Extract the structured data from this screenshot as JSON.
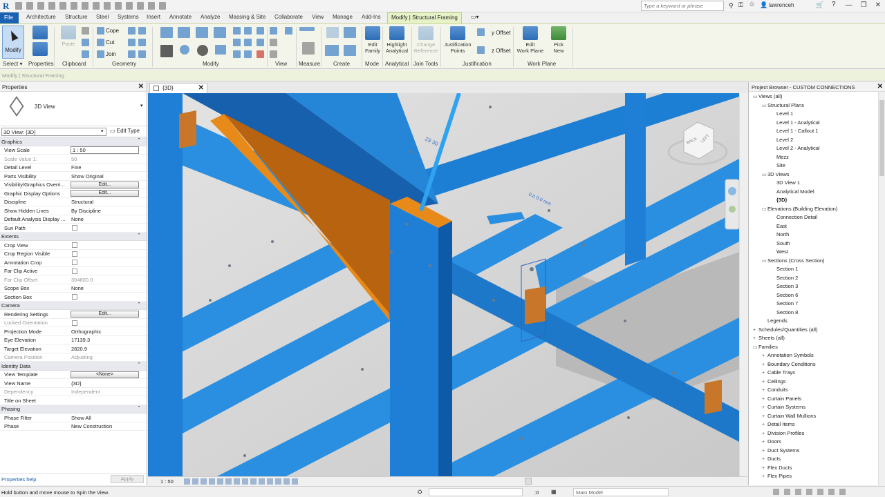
{
  "qat": {
    "logo": "R",
    "search_placeholder": "Type a keyword or phrase",
    "user": "lawrenceh",
    "window_controls": [
      "—",
      "❐",
      "✕"
    ]
  },
  "tabs": {
    "file": "File",
    "items": [
      "Architecture",
      "Structure",
      "Steel",
      "Systems",
      "Insert",
      "Annotate",
      "Analyze",
      "Massing & Site",
      "Collaborate",
      "View",
      "Manage",
      "Add-Ins"
    ],
    "contextual": "Modify | Structural Framing"
  },
  "ribbon": {
    "modify": "Modify",
    "paste": "Paste",
    "cope": "Cope",
    "cut": "Cut",
    "join": "Join",
    "edit_family": "Edit\nFamily",
    "highlight_analytical": "Highlight\nAnalytical",
    "change_reference": "Change\nReference",
    "justification_points": "Justification\nPoints",
    "y_offset": "y Offset",
    "z_offset": "z Offset",
    "edit_work_plane": "Edit\nWork Plane",
    "pick_new": "Pick\nNew",
    "groups": [
      "Select ▾",
      "Properties",
      "Clipboard",
      "Geometry",
      "Modify",
      "View",
      "Measure",
      "Create",
      "Mode",
      "Analytical",
      "Join Tools",
      "Justification",
      "Work Plane"
    ]
  },
  "options_bar": "Modify | Structural Framing",
  "properties": {
    "title": "Properties",
    "type_name": "3D View",
    "selector": "3D View: {3D}",
    "edit_type": "Edit Type",
    "rows": [
      {
        "kind": "section",
        "label": "Graphics"
      },
      {
        "kind": "input",
        "label": "View Scale",
        "value": "1 : 50"
      },
      {
        "kind": "text",
        "label": "Scale Value    1:",
        "value": "50",
        "dim": true
      },
      {
        "kind": "text",
        "label": "Detail Level",
        "value": "Fine"
      },
      {
        "kind": "text",
        "label": "Parts Visibility",
        "value": "Show Original"
      },
      {
        "kind": "button",
        "label": "Visibility/Graphics Overri...",
        "value": "Edit..."
      },
      {
        "kind": "button",
        "label": "Graphic Display Options",
        "value": "Edit..."
      },
      {
        "kind": "text",
        "label": "Discipline",
        "value": "Structural"
      },
      {
        "kind": "text",
        "label": "Show Hidden Lines",
        "value": "By Discipline"
      },
      {
        "kind": "text",
        "label": "Default Analysis Display ...",
        "value": "None"
      },
      {
        "kind": "check",
        "label": "Sun Path",
        "value": ""
      },
      {
        "kind": "section",
        "label": "Extents"
      },
      {
        "kind": "check",
        "label": "Crop View",
        "value": ""
      },
      {
        "kind": "check",
        "label": "Crop Region Visible",
        "value": ""
      },
      {
        "kind": "check",
        "label": "Annotation Crop",
        "value": ""
      },
      {
        "kind": "check",
        "label": "Far Clip Active",
        "value": ""
      },
      {
        "kind": "text",
        "label": "Far Clip Offset",
        "value": "304800.0",
        "dim": true
      },
      {
        "kind": "text",
        "label": "Scope Box",
        "value": "None"
      },
      {
        "kind": "check",
        "label": "Section Box",
        "value": ""
      },
      {
        "kind": "section",
        "label": "Camera"
      },
      {
        "kind": "button",
        "label": "Rendering Settings",
        "value": "Edit..."
      },
      {
        "kind": "check",
        "label": "Locked Orientation",
        "value": "",
        "dim": true
      },
      {
        "kind": "text",
        "label": "Projection Mode",
        "value": "Orthographic"
      },
      {
        "kind": "text",
        "label": "Eye Elevation",
        "value": "17139.3"
      },
      {
        "kind": "text",
        "label": "Target Elevation",
        "value": "2820.9"
      },
      {
        "kind": "text",
        "label": "Camera Position",
        "value": "Adjusting",
        "dim": true
      },
      {
        "kind": "section",
        "label": "Identity Data"
      },
      {
        "kind": "button",
        "label": "View Template",
        "value": "<None>"
      },
      {
        "kind": "text",
        "label": "View Name",
        "value": "{3D}"
      },
      {
        "kind": "text",
        "label": "Dependency",
        "value": "Independent",
        "dim": true
      },
      {
        "kind": "text",
        "label": "Title on Sheet",
        "value": ""
      },
      {
        "kind": "section",
        "label": "Phasing"
      },
      {
        "kind": "text",
        "label": "Phase Filter",
        "value": "Show All"
      },
      {
        "kind": "text",
        "label": "Phase",
        "value": "New Construction"
      }
    ],
    "help": "Properties help",
    "apply": "Apply"
  },
  "view": {
    "tab": "{3D}",
    "dim_a": "23 30",
    "dim_b": "0.0 0.0 mm",
    "scale": "1 : 50",
    "viewcube_front": "BACK",
    "viewcube_side": "LEFT"
  },
  "browser": {
    "title": "Project Browser - CUSTOM CONNECTIONS",
    "items": [
      {
        "t": "▭",
        "label": "Views (all)",
        "indent": 0
      },
      {
        "t": "▭",
        "label": "Structural Plans",
        "indent": 1
      },
      {
        "t": "",
        "label": "Level 1",
        "indent": 2
      },
      {
        "t": "",
        "label": "Level 1 - Analytical",
        "indent": 2
      },
      {
        "t": "",
        "label": "Level 1 - Callout 1",
        "indent": 2
      },
      {
        "t": "",
        "label": "Level 2",
        "indent": 2
      },
      {
        "t": "",
        "label": "Level 2 - Analytical",
        "indent": 2
      },
      {
        "t": "",
        "label": "Mezz",
        "indent": 2
      },
      {
        "t": "",
        "label": "Site",
        "indent": 2
      },
      {
        "t": "▭",
        "label": "3D Views",
        "indent": 1
      },
      {
        "t": "",
        "label": "3D View 1",
        "indent": 2
      },
      {
        "t": "",
        "label": "Analytical Model",
        "indent": 2
      },
      {
        "t": "",
        "label": "{3D}",
        "indent": 2,
        "sel": true
      },
      {
        "t": "▭",
        "label": "Elevations (Building Elevation)",
        "indent": 1
      },
      {
        "t": "",
        "label": "Connection Detail",
        "indent": 2
      },
      {
        "t": "",
        "label": "East",
        "indent": 2
      },
      {
        "t": "",
        "label": "North",
        "indent": 2
      },
      {
        "t": "",
        "label": "South",
        "indent": 2
      },
      {
        "t": "",
        "label": "West",
        "indent": 2
      },
      {
        "t": "▭",
        "label": "Sections (Cross Section)",
        "indent": 1
      },
      {
        "t": "",
        "label": "Section 1",
        "indent": 2
      },
      {
        "t": "",
        "label": "Section 2",
        "indent": 2
      },
      {
        "t": "",
        "label": "Section 3",
        "indent": 2
      },
      {
        "t": "",
        "label": "Section 6",
        "indent": 2
      },
      {
        "t": "",
        "label": "Section 7",
        "indent": 2
      },
      {
        "t": "",
        "label": "Section 8",
        "indent": 2
      },
      {
        "t": "",
        "label": "Legends",
        "indent": 1
      },
      {
        "t": "+",
        "label": "Schedules/Quantities (all)",
        "indent": 0
      },
      {
        "t": "+",
        "label": "Sheets (all)",
        "indent": 0
      },
      {
        "t": "▭",
        "label": "Families",
        "indent": 0
      },
      {
        "t": "+",
        "label": "Annotation Symbols",
        "indent": 1
      },
      {
        "t": "+",
        "label": "Boundary Conditions",
        "indent": 1
      },
      {
        "t": "+",
        "label": "Cable Trays",
        "indent": 1
      },
      {
        "t": "+",
        "label": "Ceilings",
        "indent": 1
      },
      {
        "t": "+",
        "label": "Conduits",
        "indent": 1
      },
      {
        "t": "+",
        "label": "Curtain Panels",
        "indent": 1
      },
      {
        "t": "+",
        "label": "Curtain Systems",
        "indent": 1
      },
      {
        "t": "+",
        "label": "Curtain Wall Mullions",
        "indent": 1
      },
      {
        "t": "+",
        "label": "Detail Items",
        "indent": 1
      },
      {
        "t": "+",
        "label": "Division Profiles",
        "indent": 1
      },
      {
        "t": "+",
        "label": "Doors",
        "indent": 1
      },
      {
        "t": "+",
        "label": "Duct Systems",
        "indent": 1
      },
      {
        "t": "+",
        "label": "Ducts",
        "indent": 1
      },
      {
        "t": "+",
        "label": "Flex Ducts",
        "indent": 1
      },
      {
        "t": "+",
        "label": "Flex Pipes",
        "indent": 1
      }
    ]
  },
  "status": {
    "message": "Hold button and move mouse to Spin the View.",
    "zero": ":0",
    "model": "Main Model"
  },
  "colors": {
    "steel_blue": "#2a8fe0",
    "steel_dark": "#1660ad",
    "plate_orange": "#e88a1a",
    "ribbon_bg": "#f3f5ea",
    "file_tab": "#1b62b3"
  }
}
